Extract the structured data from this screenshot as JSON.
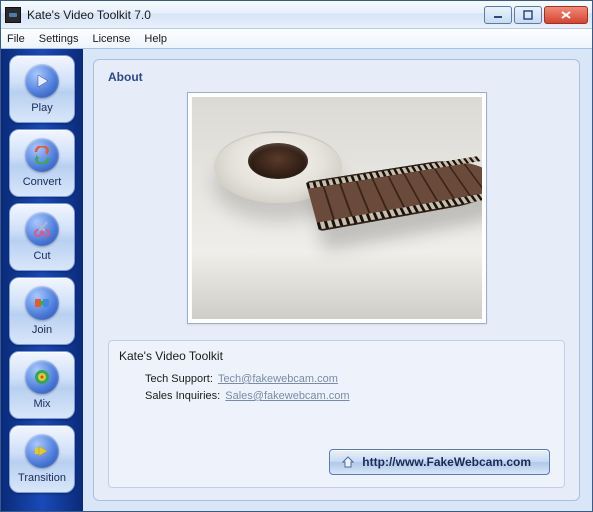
{
  "window": {
    "title": "Kate's Video Toolkit 7.0"
  },
  "menu": {
    "items": [
      "File",
      "Settings",
      "License",
      "Help"
    ]
  },
  "sidebar": {
    "items": [
      {
        "label": "Play",
        "name": "nav-play",
        "icon": "play-icon"
      },
      {
        "label": "Convert",
        "name": "nav-convert",
        "icon": "convert-icon"
      },
      {
        "label": "Cut",
        "name": "nav-cut",
        "icon": "cut-icon"
      },
      {
        "label": "Join",
        "name": "nav-join",
        "icon": "join-icon"
      },
      {
        "label": "Mix",
        "name": "nav-mix",
        "icon": "mix-icon"
      },
      {
        "label": "Transition",
        "name": "nav-transition",
        "icon": "transition-icon"
      }
    ]
  },
  "panel": {
    "title": "About",
    "product_name": "Kate's Video Toolkit",
    "support_label": "Tech Support:",
    "support_email": "Tech@fakewebcam.com",
    "sales_label": "Sales Inquiries:",
    "sales_email": "Sales@fakewebcam.com",
    "website_label": "http://www.FakeWebcam.com"
  }
}
